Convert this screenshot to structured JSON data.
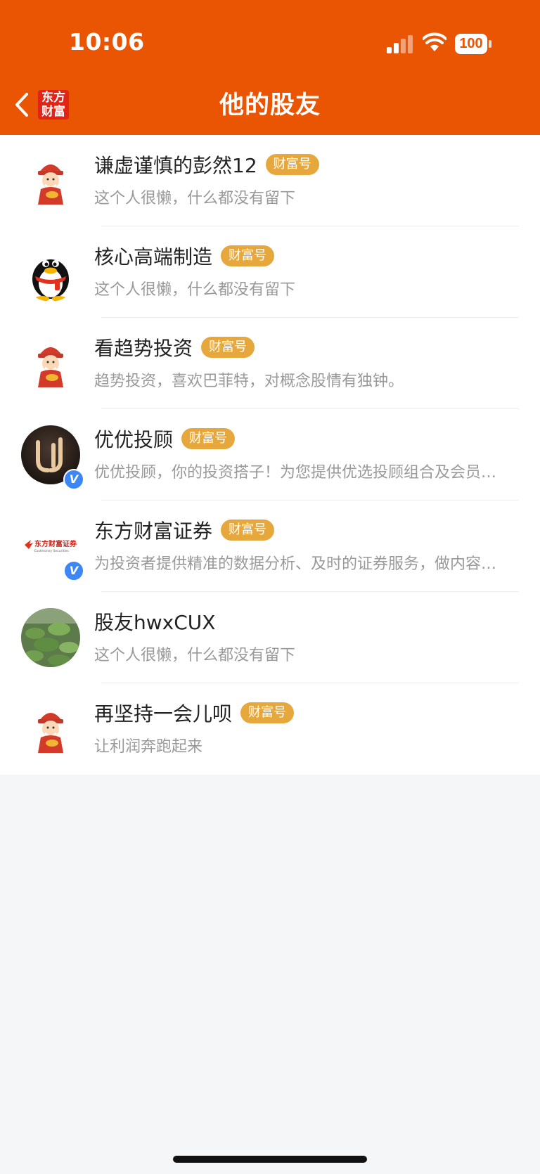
{
  "status_bar": {
    "time": "10:06",
    "battery": "100"
  },
  "header": {
    "logo_line1": "东方",
    "logo_line2": "财富",
    "title": "他的股友"
  },
  "tag_label": "财富号",
  "users": [
    {
      "name": "谦虚谨慎的彭然12",
      "tag": "财富号",
      "desc": "这个人很懒，什么都没有留下",
      "avatar": "caishen-avatar",
      "verified": false
    },
    {
      "name": "核心高端制造",
      "tag": "财富号",
      "desc": "这个人很懒，什么都没有留下",
      "avatar": "penguin-avatar",
      "verified": false
    },
    {
      "name": "看趋势投资",
      "tag": "财富号",
      "desc": "趋势投资，喜欢巴菲特，对概念股情有独钟。",
      "avatar": "caishen-avatar",
      "verified": false
    },
    {
      "name": "优优投顾",
      "tag": "财富号",
      "desc": "优优投顾，你的投资搭子！为您提供优选投顾组合及会员…",
      "avatar": "uu-logo-avatar",
      "verified": true
    },
    {
      "name": "东方财富证券",
      "tag": "财富号",
      "desc": "为投资者提供精准的数据分析、及时的证券服务，做内容…",
      "avatar": "eastmoney-securities-avatar",
      "verified": true,
      "avatar_text": "东方财富证券",
      "avatar_subtext": "Eastmoney Securities"
    },
    {
      "name": "股友hwxCUX",
      "tag": "",
      "desc": "这个人很懒，什么都没有留下",
      "avatar": "lotus-pond-avatar",
      "verified": false
    },
    {
      "name": "再坚持一会儿呗",
      "tag": "财富号",
      "desc": "让利润奔跑起来",
      "avatar": "caishen-avatar",
      "verified": false
    }
  ],
  "verified_mark": "V",
  "colors": {
    "brand": "#ea5504",
    "tag": "#e6a83c",
    "verified": "#3d86f5",
    "background": "#f5f6f8"
  }
}
